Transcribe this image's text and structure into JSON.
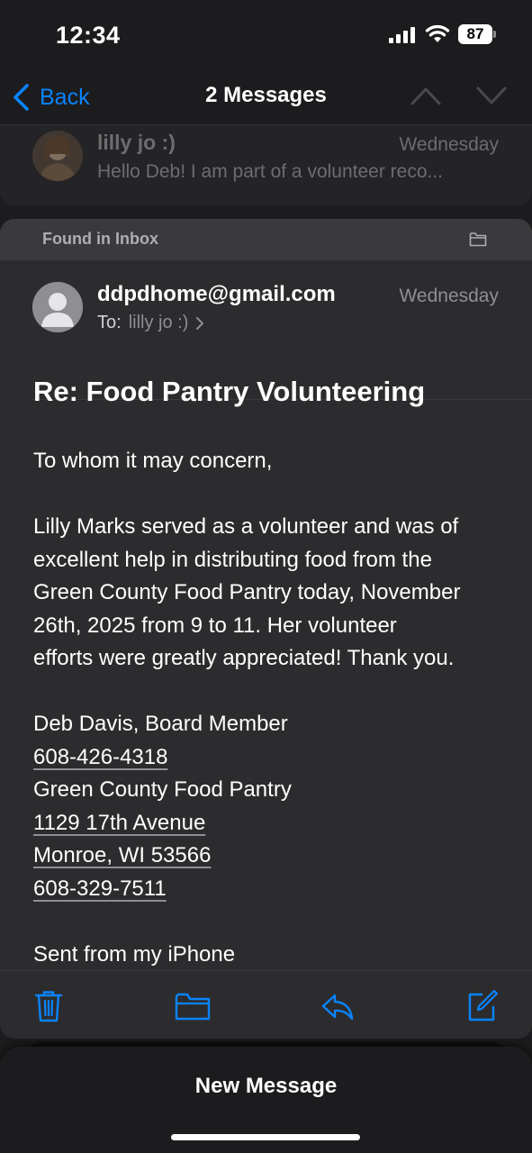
{
  "status_bar": {
    "time": "12:34",
    "battery": "87"
  },
  "nav": {
    "back_label": "Back",
    "title": "2 Messages"
  },
  "previous_message": {
    "sender": "lilly jo :)",
    "date": "Wednesday",
    "snippet": "Hello Deb! I am part of a volunteer reco..."
  },
  "message": {
    "found_label": "Found in Inbox",
    "sender": "ddpdhome@gmail.com",
    "date": "Wednesday",
    "to_label": "To:",
    "to_name": "lilly jo :)",
    "subject": "Re: Food Pantry Volunteering",
    "body": {
      "greeting": "To whom it may concern,",
      "paragraph_lines": [
        "Lilly Marks served as a volunteer and was of",
        "excellent help in distributing food from the",
        "Green County Food Pantry today, November",
        "26th, 2025 from 9 to 11. Her volunteer",
        "efforts were greatly appreciated! Thank you."
      ],
      "signature_name": "Deb Davis, Board Member",
      "phone1": "608-426-4318",
      "org": "Green County Food Pantry",
      "street": "1129 17th Avenue",
      "city": "Monroe, WI 53566",
      "phone2": "608-329-7511",
      "sent_from": "Sent from my iPhone"
    }
  },
  "toolbar": {
    "icons": [
      "trash-icon",
      "folder-icon",
      "reply-icon",
      "compose-icon"
    ]
  },
  "new_message": {
    "label": "New Message"
  },
  "colors": {
    "accent": "#0a84ff",
    "background": "#1c1c1e",
    "card": "#2c2c2e"
  }
}
